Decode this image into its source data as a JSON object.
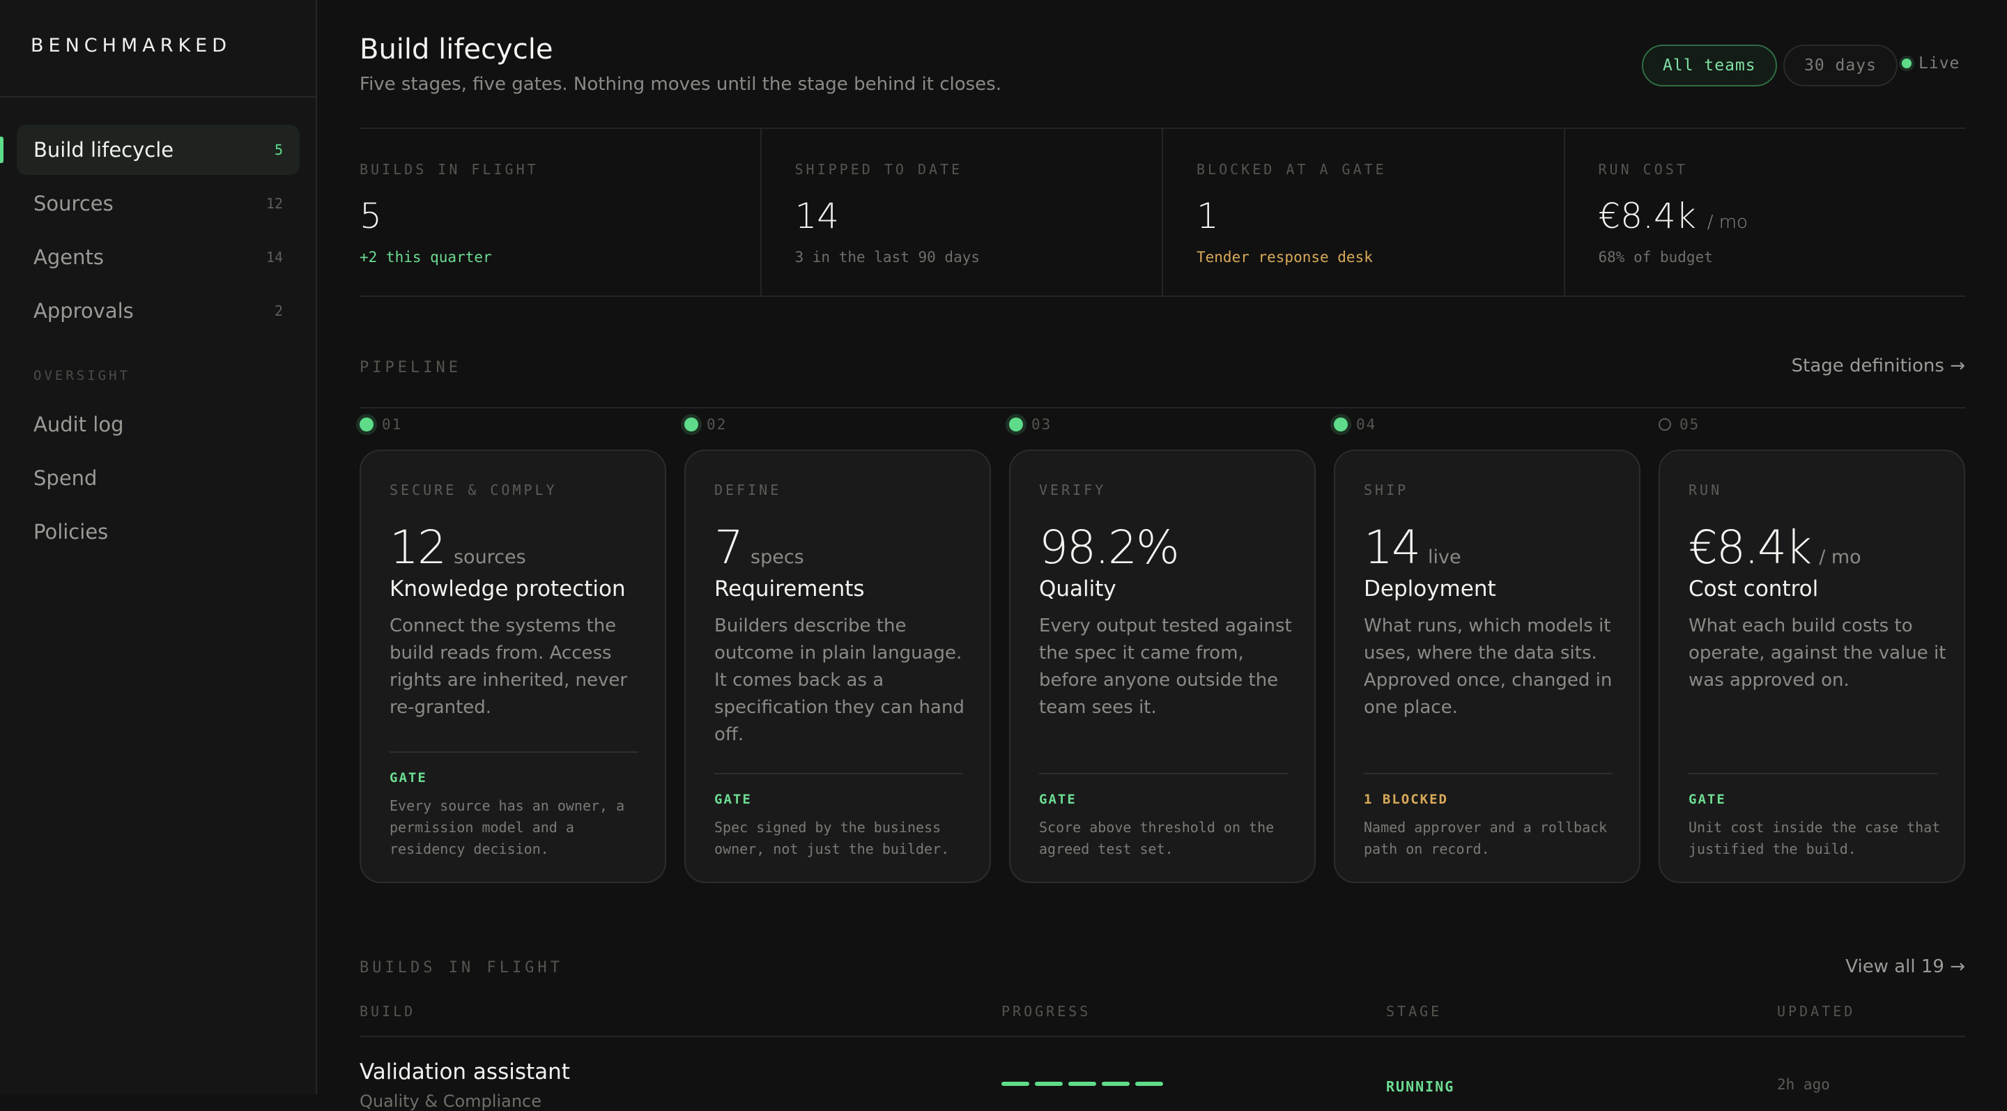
{
  "brand": "BENCHMARKED",
  "sidebar": {
    "items": [
      {
        "label": "Build lifecycle",
        "count": "5"
      },
      {
        "label": "Sources",
        "count": "12"
      },
      {
        "label": "Agents",
        "count": "14"
      },
      {
        "label": "Approvals",
        "count": "2"
      }
    ],
    "oversight_heading": "OVERSIGHT",
    "oversight_items": [
      {
        "label": "Audit log"
      },
      {
        "label": "Spend"
      },
      {
        "label": "Policies"
      }
    ]
  },
  "header": {
    "title": "Build lifecycle",
    "subtitle": "Five stages, five gates. Nothing moves until the stage behind it closes.",
    "filter_teams": "All teams",
    "filter_range": "30 days",
    "live_label": "Live"
  },
  "stats": [
    {
      "label": "BUILDS IN FLIGHT",
      "value": "5",
      "unit": "",
      "note": "+2 this quarter"
    },
    {
      "label": "SHIPPED TO DATE",
      "value": "14",
      "unit": "",
      "note": "3 in the last 90 days"
    },
    {
      "label": "BLOCKED AT A GATE",
      "value": "1",
      "unit": "",
      "note": "Tender response desk"
    },
    {
      "label": "RUN COST",
      "value": "€8.4k",
      "unit": "/ mo",
      "note": "68% of budget"
    }
  ],
  "pipeline": {
    "heading": "PIPELINE",
    "link": "Stage definitions →",
    "stages": [
      {
        "num": "01",
        "kicker": "SECURE & COMPLY",
        "value": "12",
        "unit": "sources",
        "title": "Knowledge protection",
        "desc": "Connect the systems the build reads from. Access rights are inherited, never re-granted.",
        "gate_label": "GATE",
        "gate_text": "Every source has an owner, a permission model and a residency decision."
      },
      {
        "num": "02",
        "kicker": "DEFINE",
        "value": "7",
        "unit": "specs",
        "title": "Requirements",
        "desc": "Builders describe the outcome in plain language. It comes back as a specification they can hand off.",
        "gate_label": "GATE",
        "gate_text": "Spec signed by the business owner, not just the builder."
      },
      {
        "num": "03",
        "kicker": "VERIFY",
        "value": "98.2%",
        "unit": "",
        "title": "Quality",
        "desc": "Every output tested against the spec it came from, before anyone outside the team sees it.",
        "gate_label": "GATE",
        "gate_text": "Score above threshold on the agreed test set."
      },
      {
        "num": "04",
        "kicker": "SHIP",
        "value": "14",
        "unit": "live",
        "title": "Deployment",
        "desc": "What runs, which models it uses, where the data sits. Approved once, changed in one place.",
        "gate_label": "1 BLOCKED",
        "gate_text": "Named approver and a rollback path on record."
      },
      {
        "num": "05",
        "kicker": "RUN",
        "value": "€8.4k",
        "unit": "/ mo",
        "title": "Cost control",
        "desc": "What each build costs to operate, against the value it was approved on.",
        "gate_label": "GATE",
        "gate_text": "Unit cost inside the case that justified the build."
      }
    ]
  },
  "builds": {
    "heading": "BUILDS IN FLIGHT",
    "link": "View all 19 →",
    "columns": [
      "BUILD",
      "PROGRESS",
      "STAGE",
      "UPDATED"
    ],
    "rows": [
      {
        "name": "Validation assistant",
        "meta": "Quality & Compliance",
        "progress_steps": 5,
        "progress_total": 5,
        "stage": "RUNNING",
        "updated": "2h ago"
      }
    ]
  },
  "colors": {
    "accent": "#5fdc8a",
    "warning": "#d9aa5a",
    "background": "#111111"
  }
}
